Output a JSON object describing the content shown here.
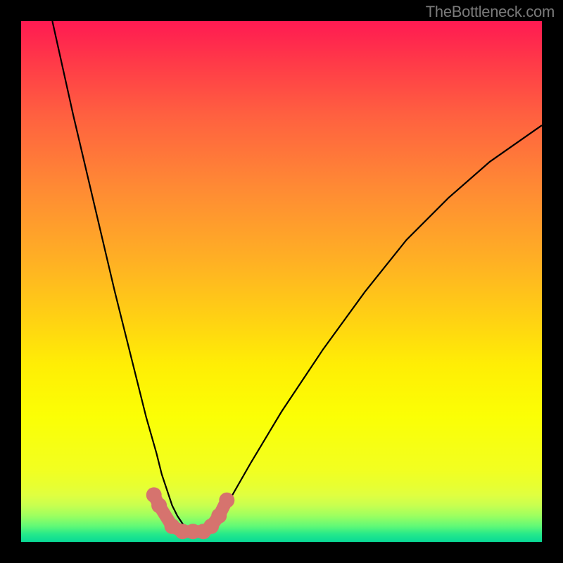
{
  "watermark": "TheBottleneck.com",
  "chart_data": {
    "type": "line",
    "title": "",
    "xlabel": "",
    "ylabel": "",
    "xlim": [
      0,
      100
    ],
    "ylim": [
      0,
      100
    ],
    "legend": false,
    "grid": false,
    "annotations": [],
    "series": [
      {
        "name": "bottleneck-curve",
        "color": "#000000",
        "x": [
          6,
          10,
          14,
          18,
          22,
          24,
          26,
          27,
          28,
          29,
          30,
          31,
          32,
          33,
          34,
          35,
          36,
          37,
          38,
          40,
          44,
          50,
          58,
          66,
          74,
          82,
          90,
          100
        ],
        "y": [
          100,
          82,
          65,
          48,
          32,
          24,
          17,
          13,
          10,
          7,
          5,
          3.5,
          2.5,
          2,
          2,
          2,
          2.5,
          3.5,
          5,
          8,
          15,
          25,
          37,
          48,
          58,
          66,
          73,
          80
        ]
      },
      {
        "name": "highlight-markers",
        "color": "#d6736e",
        "x": [
          25.5,
          26.5,
          29,
          31,
          33,
          35,
          36.5,
          38,
          39.5
        ],
        "y": [
          9,
          7,
          3,
          2,
          2,
          2,
          3,
          5,
          8
        ]
      }
    ],
    "background_gradient_stops": [
      {
        "pos": 0.0,
        "color": "#ff1a52"
      },
      {
        "pos": 0.18,
        "color": "#ff6040"
      },
      {
        "pos": 0.46,
        "color": "#ffb024"
      },
      {
        "pos": 0.66,
        "color": "#ffee05"
      },
      {
        "pos": 0.86,
        "color": "#f2ff20"
      },
      {
        "pos": 0.95,
        "color": "#9cff60"
      },
      {
        "pos": 1.0,
        "color": "#08d996"
      }
    ]
  }
}
